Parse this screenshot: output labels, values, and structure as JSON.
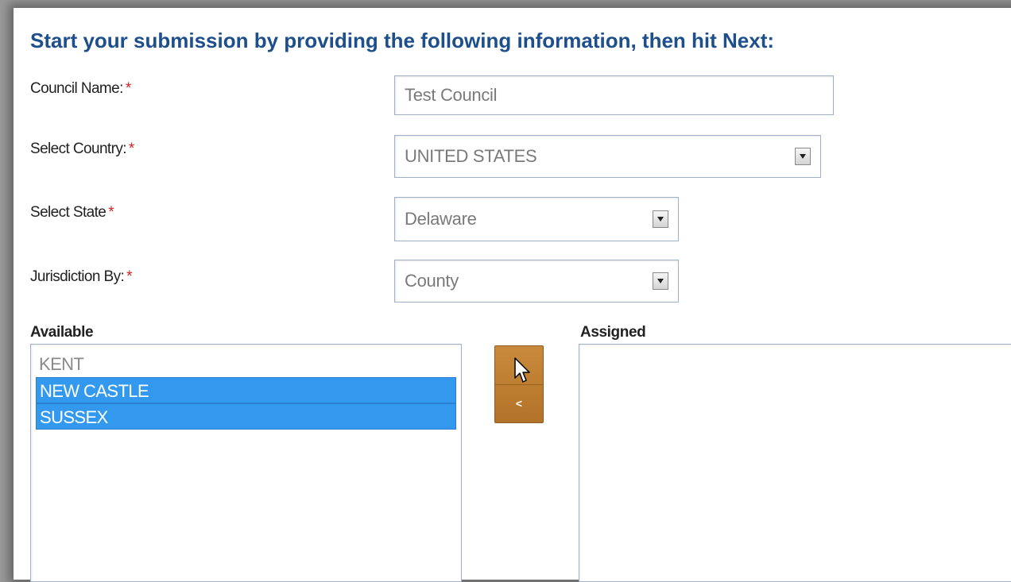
{
  "form": {
    "heading": "Start your submission by providing the following information, then hit Next:",
    "required_marker": "*",
    "council_name": {
      "label": "Council Name:",
      "value": "Test Council"
    },
    "country": {
      "label": "Select Country:",
      "value": "UNITED STATES"
    },
    "state": {
      "label": "Select State",
      "value": "Delaware"
    },
    "jurisdiction": {
      "label": "Jurisdiction By:",
      "value": "County"
    }
  },
  "available": {
    "label": "Available",
    "items": [
      {
        "text": "KENT",
        "selected": false
      },
      {
        "text": "NEW CASTLE",
        "selected": true
      },
      {
        "text": "SUSSEX",
        "selected": true
      }
    ]
  },
  "assigned": {
    "label": "Assigned",
    "items": []
  },
  "move_buttons": {
    "add_label": ">",
    "remove_label": "<"
  },
  "colors": {
    "heading": "#1d4f8c",
    "required": "#d42020",
    "selection": "#3399ee",
    "move_button": "#c07f32"
  },
  "icons": {
    "dropdown": "dropdown-arrow-icon",
    "cursor": "mouse-pointer-icon"
  }
}
